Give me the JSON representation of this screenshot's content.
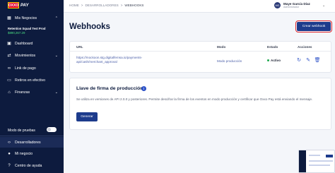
{
  "logo": {
    "brand_top": "OXXO",
    "brand_bottom": "PAY",
    "tagline": "Oxxo Pay"
  },
  "sidebar": {
    "business_menu": "Mis Negocios",
    "account_name": "Retention Squad Test Prod",
    "account_balance": "$890,267.29",
    "items": [
      {
        "label": "Dashboard",
        "icon": "dashboard-icon"
      },
      {
        "label": "Movimientos",
        "icon": "swap-icon"
      },
      {
        "label": "Link de pago",
        "icon": "link-icon"
      },
      {
        "label": "Retiros en efectivo",
        "icon": "wallet-icon"
      },
      {
        "label": "Finanzas",
        "icon": "bank-icon"
      }
    ],
    "test_mode_label": "Modo de pruebas",
    "bottom_items": [
      {
        "label": "Desarrolladores",
        "icon": "code-icon"
      },
      {
        "label": "Mi negocio",
        "icon": "user-icon"
      },
      {
        "label": "Centro de ayuda",
        "icon": "help-icon"
      }
    ]
  },
  "breadcrumb": {
    "home": "HOME",
    "sep": ">",
    "section": "DESARROLLADORES",
    "current": "WEBHOOKS"
  },
  "user": {
    "initials": "MG",
    "name": "Maye García Díaz",
    "role": "Administrador"
  },
  "page": {
    "title": "Webhooks",
    "create_button": "Crear webhook"
  },
  "table": {
    "headers": {
      "url": "URL",
      "mode": "Modo",
      "status": "Estado",
      "actions": "Acciones"
    },
    "row": {
      "url": "https://mockoon.stg.digitalfemsa.io/payments-api/cash/merchant_approval",
      "mode": "Modo producción",
      "status": "Activo"
    }
  },
  "signature": {
    "title": "Llave de firma de producción",
    "description": "Se utiliza en versiones de API 2.0.0 y posteriores. Permite descifrar la firma de los eventos en modo producción y certificar que Oxxo Pay está enviando el mensaje.",
    "generate_button": "Generar"
  },
  "colors": {
    "sidebar": "#0d1b3e",
    "primary": "#1d3b8c",
    "status_active": "#1fa84f",
    "highlight": "#e0262c"
  }
}
